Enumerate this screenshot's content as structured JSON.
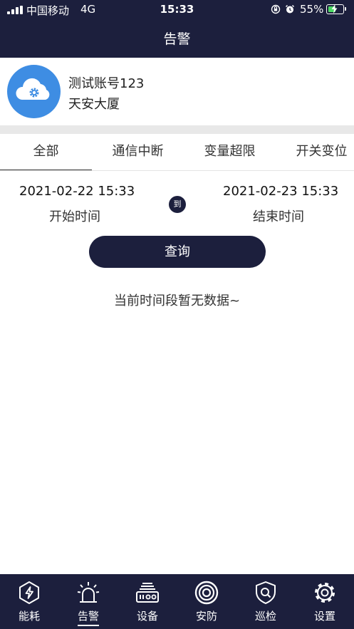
{
  "status_bar": {
    "carrier": "中国移动",
    "network": "4G",
    "time": "15:33",
    "battery": "55%",
    "battery_level": 0.55
  },
  "header": {
    "title": "告警"
  },
  "account": {
    "name": "测试账号123",
    "site": "天安大厦"
  },
  "tabs": [
    {
      "label": "全部",
      "active": true
    },
    {
      "label": "通信中断",
      "active": false
    },
    {
      "label": "变量超限",
      "active": false
    },
    {
      "label": "开关变位",
      "active": false
    }
  ],
  "range": {
    "start": "2021-02-22 15:33",
    "start_label": "开始时间",
    "to": "到",
    "end": "2021-02-23 15:33",
    "end_label": "结束时间"
  },
  "query_button": "查询",
  "empty_message": "当前时间段暂无数据~",
  "bottom_nav": [
    {
      "label": "能耗",
      "icon": "energy-icon",
      "active": false
    },
    {
      "label": "告警",
      "icon": "alarm-icon",
      "active": true
    },
    {
      "label": "设备",
      "icon": "device-icon",
      "active": false
    },
    {
      "label": "安防",
      "icon": "security-icon",
      "active": false
    },
    {
      "label": "巡检",
      "icon": "patrol-icon",
      "active": false
    },
    {
      "label": "设置",
      "icon": "settings-icon",
      "active": false
    }
  ],
  "colors": {
    "primary": "#1c1f3d",
    "avatar_blue": "#3e8de3",
    "battery_green": "#4cd964"
  }
}
